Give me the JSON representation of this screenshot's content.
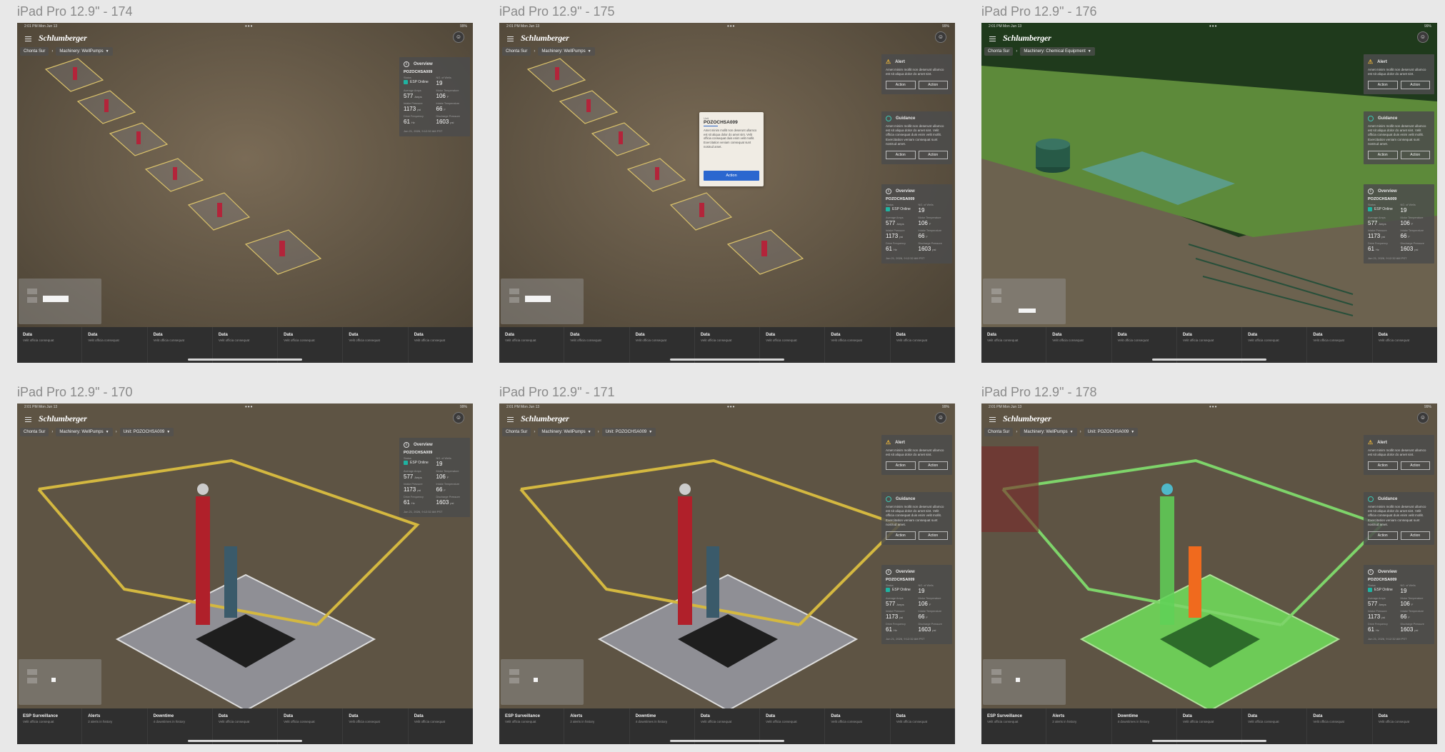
{
  "texts": {
    "logo": "Schlumberger",
    "menu_icon": "hamburger-menu-icon",
    "account_icon": "account-icon",
    "status_dots": "•••",
    "overview_title": "Overview",
    "alert_title": "Alert",
    "guidance_title": "Guidance",
    "panel_body": "Amet minim mollit non deserunt ullamco est sit aliqua dolor do amet sint.",
    "guidance_body": "Amet minim mollit non deserunt ullamco est sit aliqua dolor do amet sint. Velit officia consequat duis enim velit mollit. Exercitation veniam consequat sunt nostrud amet.",
    "action": "Action",
    "well_id": "POZOCHSA009",
    "status_label": "Status",
    "status_value": "ESP Online",
    "wells_label": "NO. of Wells",
    "wells_value": "19",
    "amps_label": "Average Amps",
    "amps_value": "577",
    "amps_unit": "Amps",
    "motor_temp_label": "Motor Temperature",
    "motor_temp_value": "106",
    "motor_temp_unit": "F",
    "intake_label": "Intake Pressure",
    "intake_value": "1173",
    "intake_unit": "psi",
    "intake_temp_label": "Intake Temperature",
    "intake_temp_value": "66",
    "intake_temp_unit": "F",
    "freq_label": "Drive Frequency",
    "freq_value": "61",
    "freq_unit": "Hz",
    "discharge_label": "Discharge Pressure",
    "discharge_value": "1603",
    "discharge_unit": "psi",
    "timestamp": "Jun 21, 2026, 9:12:32 AM PST",
    "popup_label": "Unit",
    "popup_title": "POZOCHSA009",
    "popup_body": "Amet minim mollit non deserunt ullamco est sit aliqua dolor do amet sint. Velit officia consequat duis enim velit mollit. Exercitation veniam consequat sunt nostrud amet."
  },
  "breadcrumb": {
    "site": "Chonta Sur",
    "machinery_wellpumps": "Machinery: WellPumps",
    "machinery_chemical": "Machinery: Chemical Equipment",
    "unit": "Unit: POZOCHSA009"
  },
  "bottom_simple": [
    {
      "title": "Data",
      "sub": "Velit officia consequat"
    },
    {
      "title": "Data",
      "sub": "Velit officia consequat"
    },
    {
      "title": "Data",
      "sub": "Velit officia consequat"
    },
    {
      "title": "Data",
      "sub": "Velit officia consequat"
    },
    {
      "title": "Data",
      "sub": "Velit officia consequat"
    },
    {
      "title": "Data",
      "sub": "Velit officia consequat"
    },
    {
      "title": "Data",
      "sub": "Velit officia consequat"
    }
  ],
  "bottom_unit": [
    {
      "title": "ESP Surveillance",
      "sub": "Velit officia consequat"
    },
    {
      "title": "Alerts",
      "sub": "2 alerts in history"
    },
    {
      "title": "Downtime",
      "sub": "4 downtimes in history"
    },
    {
      "title": "Data",
      "sub": "Velit officia consequat"
    },
    {
      "title": "Data",
      "sub": "Velit officia consequat"
    },
    {
      "title": "Data",
      "sub": "Velit officia consequat"
    },
    {
      "title": "Data",
      "sub": "Velit officia consequat"
    }
  ],
  "artboards": [
    {
      "title": "iPad Pro 12.9\" - 174",
      "time": "2:01 PM  Mon Jun 13",
      "battery": "99%"
    },
    {
      "title": "iPad Pro 12.9\" - 175",
      "time": "2:01 PM  Mon Jun 13",
      "battery": "99%"
    },
    {
      "title": "iPad Pro 12.9\" - 176",
      "time": "2:01 PM  Mon Jun 13",
      "battery": "99%"
    },
    {
      "title": "iPad Pro 12.9\" - 170",
      "time": "2:01 PM  Mon Jun 13",
      "battery": "99%"
    },
    {
      "title": "iPad Pro 12.9\" - 171",
      "time": "2:01 PM  Mon Jun 13",
      "battery": "99%"
    },
    {
      "title": "iPad Pro 12.9\" - 178",
      "time": "2:01 PM  Mon Jun 13",
      "battery": "99%"
    }
  ]
}
